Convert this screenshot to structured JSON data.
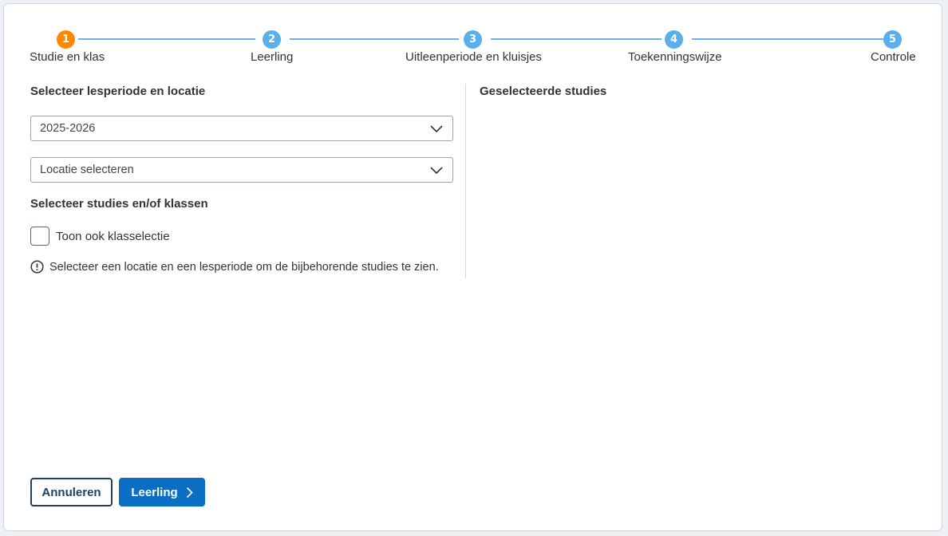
{
  "stepper": {
    "steps": [
      {
        "number": "1",
        "label": "Studie en klas",
        "active": true
      },
      {
        "number": "2",
        "label": "Leerling",
        "active": false
      },
      {
        "number": "3",
        "label": "Uitleenperiode en kluisjes",
        "active": false
      },
      {
        "number": "4",
        "label": "Toekenningswijze",
        "active": false
      },
      {
        "number": "5",
        "label": "Controle",
        "active": false
      }
    ],
    "colors": {
      "active": "#ff8800",
      "inactive": "#5aaeea",
      "line": "#6cb3e6"
    }
  },
  "left": {
    "period_title": "Selecteer lesperiode en locatie",
    "period_select": "2025-2026",
    "location_select": "Locatie selecteren",
    "studies_title": "Selecteer studies en/of klassen",
    "class_checkbox_label": "Toon ook klasselectie",
    "info_text": "Selecteer een locatie en een lesperiode om de bijbehorende studies te zien."
  },
  "right": {
    "selected_title": "Geselecteerde studies"
  },
  "footer": {
    "cancel_label": "Annuleren",
    "next_label": "Leerling"
  },
  "icons": {
    "select_chevron": "chevron-down-icon",
    "info": "info-icon",
    "next_chevron": "chevron-right-icon"
  }
}
